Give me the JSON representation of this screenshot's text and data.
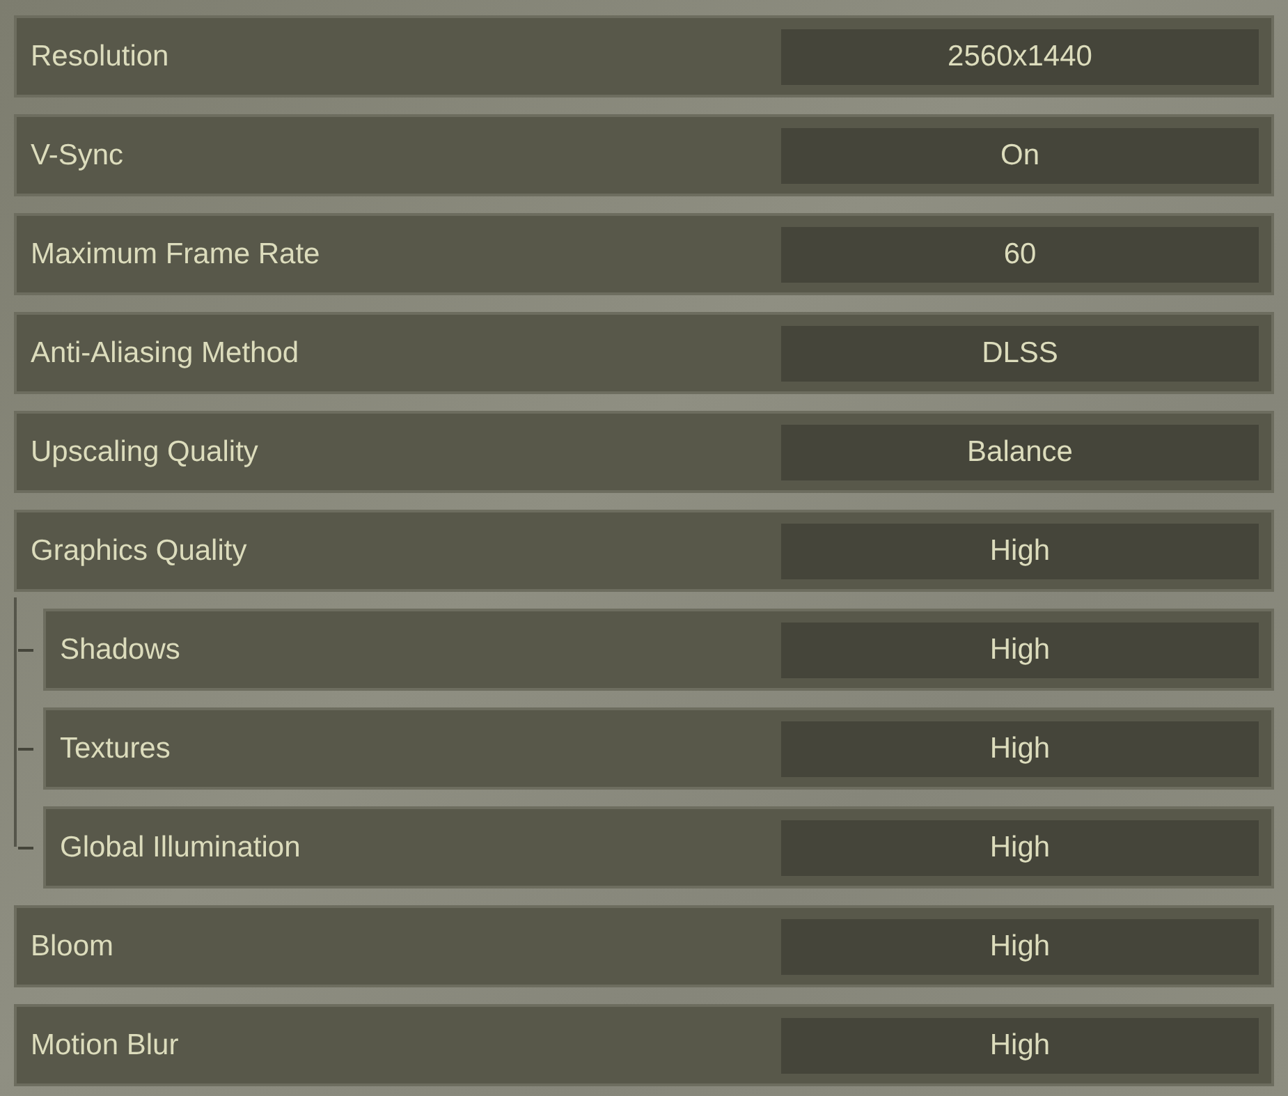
{
  "settings": [
    {
      "label": "Resolution",
      "value": "2560x1440"
    },
    {
      "label": "V-Sync",
      "value": "On"
    },
    {
      "label": "Maximum Frame Rate",
      "value": "60"
    },
    {
      "label": "Anti-Aliasing Method",
      "value": "DLSS"
    },
    {
      "label": "Upscaling Quality",
      "value": "Balance"
    },
    {
      "label": "Graphics Quality",
      "value": "High",
      "children": [
        {
          "label": "Shadows",
          "value": "High"
        },
        {
          "label": "Textures",
          "value": "High"
        },
        {
          "label": "Global Illumination",
          "value": "High"
        }
      ]
    },
    {
      "label": "Bloom",
      "value": "High"
    },
    {
      "label": "Motion Blur",
      "value": "High"
    }
  ]
}
